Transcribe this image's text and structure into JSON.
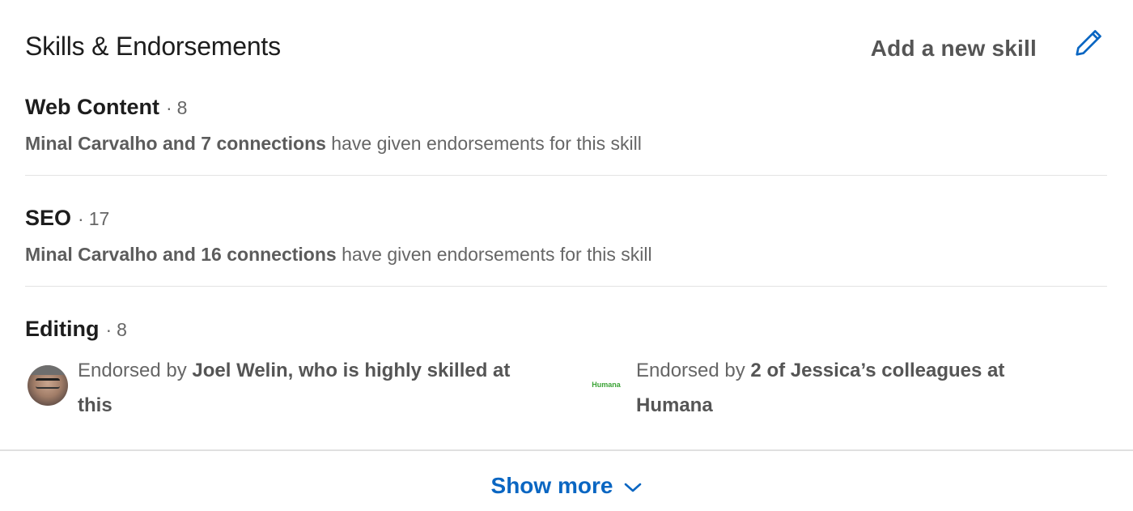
{
  "header": {
    "title": "Skills & Endorsements",
    "add_skill_label": "Add a new skill",
    "edit_icon": "pencil-icon"
  },
  "skills": [
    {
      "name": "Web Content",
      "separator": "·",
      "count": "8",
      "endorsers_bold": "Minal Carvalho and 7 connections",
      "endorsers_rest": " have given endorsements for this skill"
    },
    {
      "name": "SEO",
      "separator": "·",
      "count": "17",
      "endorsers_bold": "Minal Carvalho and 16 connections",
      "endorsers_rest": " have given endorsements for this skill"
    },
    {
      "name": "Editing",
      "separator": "·",
      "count": "8",
      "highlights": [
        {
          "prefix": "Endorsed by ",
          "bold_line1": "Joel Welin, who is highly skilled at",
          "bold_line2": "this",
          "image": "avatar"
        },
        {
          "prefix": "Endorsed by ",
          "bold_line1": "2 of Jessica’s colleagues at",
          "bold_line2": "Humana",
          "image": "company-logo",
          "logo_text": "Humana"
        }
      ]
    }
  ],
  "footer": {
    "show_more_label": "Show more",
    "chevron_icon": "chevron-down-icon"
  },
  "colors": {
    "link_blue": "#0a66c2",
    "text_primary": "#1d1d1d",
    "text_secondary": "#666666",
    "humana_green": "#3aa335"
  }
}
